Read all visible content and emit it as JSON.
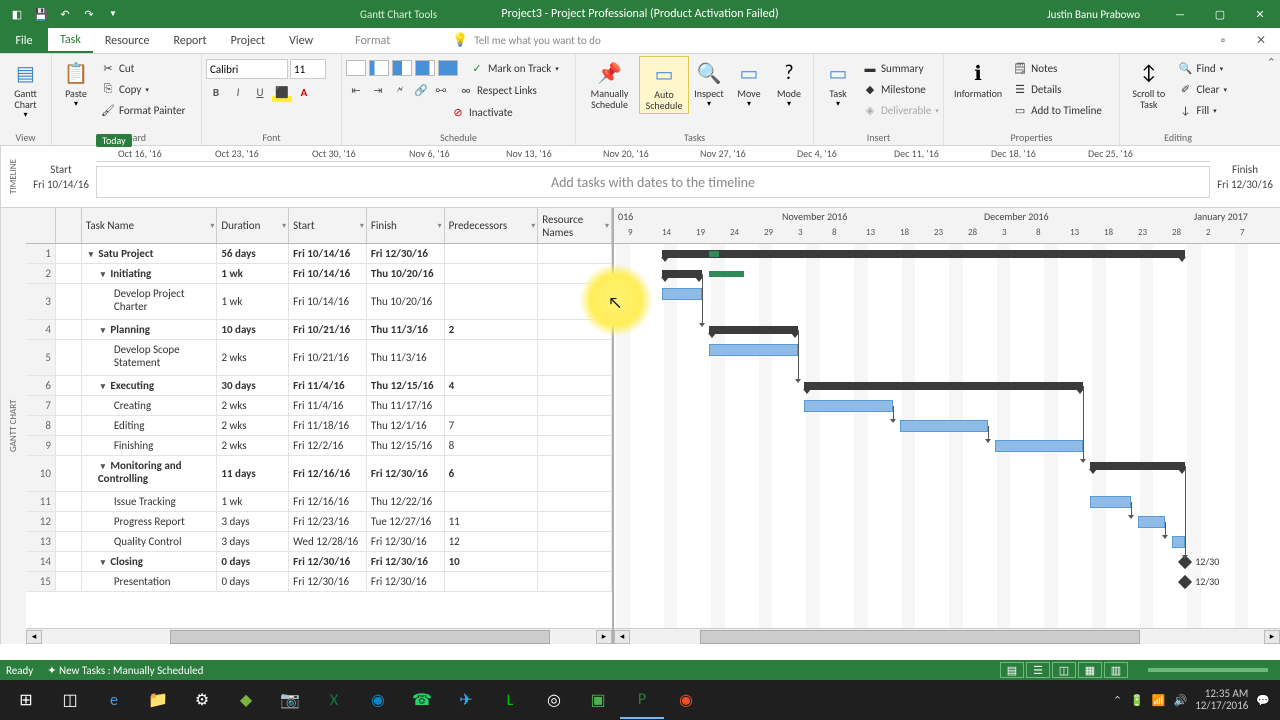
{
  "titlebar": {
    "tools": "Gantt Chart Tools",
    "title": "Project3 - Project Professional (Product Activation Failed)",
    "user": "Justin Banu Prabowo"
  },
  "tabs": {
    "file": "File",
    "task": "Task",
    "resource": "Resource",
    "report": "Report",
    "project": "Project",
    "view": "View",
    "format": "Format",
    "tellme": "Tell me what you want to do"
  },
  "ribbon": {
    "view_label": "View",
    "gantt": "Gantt Chart",
    "paste": "Paste",
    "cut": "Cut",
    "copy": "Copy",
    "format_painter": "Format Painter",
    "clipboard": "Clipboard",
    "font_name": "Calibri",
    "font_size": "11",
    "font": "Font",
    "schedule": "Schedule",
    "mark_on_track": "Mark on Track",
    "respect_links": "Respect Links",
    "inactivate": "Inactivate",
    "manually": "Manually Schedule",
    "auto": "Auto Schedule",
    "inspect": "Inspect",
    "move": "Move",
    "mode": "Mode",
    "tasks": "Tasks",
    "task_btn": "Task",
    "summary": "Summary",
    "milestone": "Milestone",
    "deliverable": "Deliverable",
    "insert": "Insert",
    "information": "Information",
    "notes": "Notes",
    "details": "Details",
    "add_timeline": "Add to Timeline",
    "properties": "Properties",
    "scroll_to_task": "Scroll to Task",
    "find": "Find",
    "clear": "Clear",
    "fill": "Fill",
    "editing": "Editing"
  },
  "timeline": {
    "side": "TIMELINE",
    "today": "Today",
    "start_lbl": "Start",
    "start_date": "Fri 10/14/16",
    "finish_lbl": "Finish",
    "finish_date": "Fri 12/30/16",
    "hint": "Add tasks with dates to the timeline",
    "dates": [
      "Oct 16, '16",
      "Oct 23, '16",
      "Oct 30, '16",
      "Nov 6, '16",
      "Nov 13, '16",
      "Nov 20, '16",
      "Nov 27, '16",
      "Dec 4, '16",
      "Dec 11, '16",
      "Dec 18, '16",
      "Dec 25, '16"
    ]
  },
  "gantt_side": "GANTT CHART",
  "columns": {
    "task": "Task Name",
    "duration": "Duration",
    "start": "Start",
    "finish": "Finish",
    "pred": "Predecessors",
    "res": "Resource Names"
  },
  "g_header": {
    "part_month_right": "016",
    "months": [
      "November 2016",
      "December 2016",
      "January 2017"
    ],
    "days": [
      "9",
      "14",
      "19",
      "24",
      "29",
      "3",
      "8",
      "13",
      "18",
      "23",
      "28",
      "3",
      "8",
      "13",
      "18",
      "23",
      "28",
      "2",
      "7"
    ]
  },
  "rows": [
    {
      "n": "1",
      "name": "Satu Project",
      "dur": "56 days",
      "start": "Fri 10/14/16",
      "finish": "Fri 12/30/16",
      "pred": "",
      "lvl": 0,
      "sum": true
    },
    {
      "n": "2",
      "name": "Initiating",
      "dur": "1 wk",
      "start": "Fri 10/14/16",
      "finish": "Thu 10/20/16",
      "pred": "",
      "lvl": 1,
      "sum": true
    },
    {
      "n": "3",
      "name": "Develop Project Charter",
      "dur": "1 wk",
      "start": "Fri 10/14/16",
      "finish": "Thu 10/20/16",
      "pred": "",
      "lvl": 2,
      "double": true
    },
    {
      "n": "4",
      "name": "Planning",
      "dur": "10 days",
      "start": "Fri 10/21/16",
      "finish": "Thu 11/3/16",
      "pred": "2",
      "lvl": 1,
      "sum": true
    },
    {
      "n": "5",
      "name": "Develop Scope Statement",
      "dur": "2 wks",
      "start": "Fri 10/21/16",
      "finish": "Thu 11/3/16",
      "pred": "",
      "lvl": 2,
      "double": true
    },
    {
      "n": "6",
      "name": "Executing",
      "dur": "30 days",
      "start": "Fri 11/4/16",
      "finish": "Thu 12/15/16",
      "pred": "4",
      "lvl": 1,
      "sum": true
    },
    {
      "n": "7",
      "name": "Creating",
      "dur": "2 wks",
      "start": "Fri 11/4/16",
      "finish": "Thu 11/17/16",
      "pred": "",
      "lvl": 2
    },
    {
      "n": "8",
      "name": "Editing",
      "dur": "2 wks",
      "start": "Fri 11/18/16",
      "finish": "Thu 12/1/16",
      "pred": "7",
      "lvl": 2
    },
    {
      "n": "9",
      "name": "Finishing",
      "dur": "2 wks",
      "start": "Fri 12/2/16",
      "finish": "Thu 12/15/16",
      "pred": "8",
      "lvl": 2
    },
    {
      "n": "10",
      "name": "Monitoring and Controlling",
      "dur": "11 days",
      "start": "Fri 12/16/16",
      "finish": "Fri 12/30/16",
      "pred": "6",
      "lvl": 1,
      "sum": true,
      "double": true
    },
    {
      "n": "11",
      "name": "Issue Tracking",
      "dur": "1 wk",
      "start": "Fri 12/16/16",
      "finish": "Thu 12/22/16",
      "pred": "",
      "lvl": 2
    },
    {
      "n": "12",
      "name": "Progress Report",
      "dur": "3 days",
      "start": "Fri 12/23/16",
      "finish": "Tue 12/27/16",
      "pred": "11",
      "lvl": 2
    },
    {
      "n": "13",
      "name": "Quality Control",
      "dur": "3 days",
      "start": "Wed 12/28/16",
      "finish": "Fri 12/30/16",
      "pred": "12",
      "lvl": 2
    },
    {
      "n": "14",
      "name": "Closing",
      "dur": "0 days",
      "start": "Fri 12/30/16",
      "finish": "Fri 12/30/16",
      "pred": "10",
      "lvl": 1,
      "sum": true
    },
    {
      "n": "15",
      "name": "Presentation",
      "dur": "0 days",
      "start": "Fri 12/30/16",
      "finish": "Fri 12/30/16",
      "pred": "",
      "lvl": 2
    }
  ],
  "ms_label": "12/30",
  "status": {
    "ready": "Ready",
    "new_tasks": "New Tasks : Manually Scheduled"
  },
  "clock": {
    "time": "12:35 AM",
    "date": "12/17/2016"
  }
}
